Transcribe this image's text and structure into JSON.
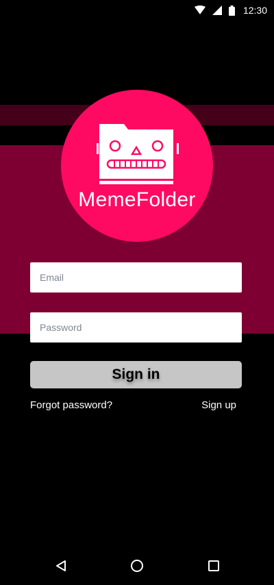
{
  "status_bar": {
    "time": "12:30",
    "icons": [
      "wifi-icon",
      "cell-signal-icon",
      "battery-icon"
    ]
  },
  "logo": {
    "app_name": "MemeFolder",
    "icon": "robot-folder-icon"
  },
  "login_form": {
    "email_placeholder": "Email",
    "email_value": "",
    "password_placeholder": "Password",
    "password_value": "",
    "signin_label": "Sign in",
    "forgot_password_label": "Forgot password?",
    "signup_label": "Sign up"
  },
  "nav_bar": {
    "icons": [
      "back-icon",
      "home-icon",
      "recents-icon"
    ]
  },
  "colors": {
    "background": "#000000",
    "band_main": "#7e0033",
    "band_dark": "#440018",
    "logo_circle": "#ff0a62",
    "button": "#c6c6c6"
  }
}
